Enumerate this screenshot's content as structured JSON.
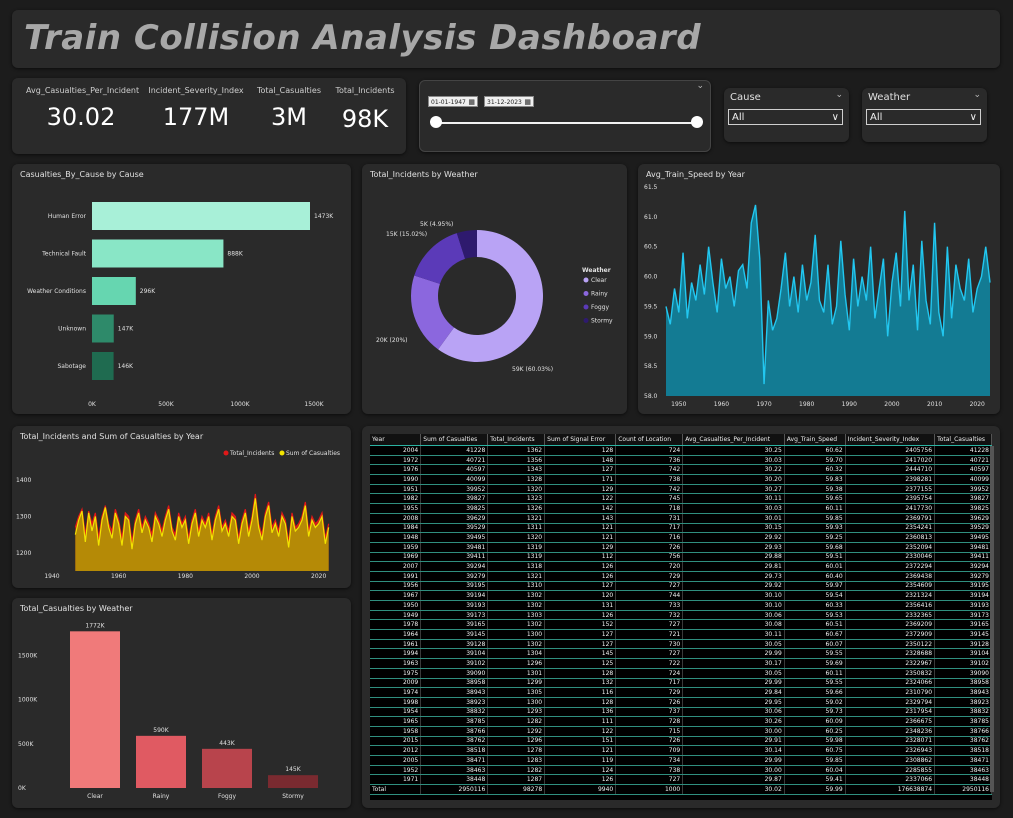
{
  "title": "Train Collision Analysis Dashboard",
  "kpis": [
    {
      "label": "Avg_Casualties_Per_Incident",
      "value": "30.02"
    },
    {
      "label": "Incident_Severity_Index",
      "value": "177M"
    },
    {
      "label": "Total_Casualties",
      "value": "3M"
    },
    {
      "label": "Total_Incidents",
      "value": "98K"
    }
  ],
  "date_slicer": {
    "start": "01-01-1947",
    "end": "31-12-2023",
    "cal_icon": "calendar-icon"
  },
  "cause_slicer": {
    "label": "Cause",
    "selected": "All"
  },
  "weather_slicer": {
    "label": "Weather",
    "selected": "All"
  },
  "cause_chart": {
    "title": "Casualties_By_Cause by Cause",
    "type": "bar",
    "categories": [
      "Human Error",
      "Technical Fault",
      "Weather Conditions",
      "Unknown",
      "Sabotage"
    ],
    "values": [
      1473,
      888,
      296,
      147,
      146
    ],
    "labels": [
      "1473K",
      "888K",
      "296K",
      "147K",
      "146K"
    ],
    "colors": [
      "#a8f0d8",
      "#89e6c6",
      "#66d6b0",
      "#2e8a6a",
      "#1f6b50"
    ],
    "xticks": [
      "0K",
      "500K",
      "1000K",
      "1500K"
    ],
    "xmax": 1500
  },
  "weather_donut": {
    "title": "Total_Incidents by Weather",
    "legend_title": "Weather",
    "slices": [
      {
        "name": "Clear",
        "value": 60.03,
        "color": "#b9a3f5",
        "label": "59K (60.03%)"
      },
      {
        "name": "Rainy",
        "value": 20,
        "color": "#8b67de",
        "label": "20K (20%)"
      },
      {
        "name": "Foggy",
        "value": 15.02,
        "color": "#5b3ab8",
        "label": "15K (15.02%)"
      },
      {
        "name": "Stormy",
        "value": 4.95,
        "color": "#2e1a6e",
        "label": "5K (4.95%)"
      }
    ]
  },
  "speed_chart": {
    "title": "Avg_Train_Speed by Year",
    "type": "area",
    "yticks": [
      "61.5",
      "61.0",
      "60.5",
      "60.0",
      "59.5",
      "59.0",
      "58.5",
      "58.0"
    ],
    "ymin": 58.0,
    "ymax": 61.5,
    "xticks": [
      "1950",
      "1960",
      "1970",
      "1980",
      "1990",
      "2000",
      "2010",
      "2020"
    ],
    "xmin": 1947,
    "xmax": 2023,
    "values": [
      59.5,
      59.2,
      59.8,
      59.4,
      60.4,
      59.3,
      59.9,
      59.6,
      60.2,
      59.7,
      60.5,
      59.9,
      59.4,
      60.3,
      59.8,
      60.0,
      59.5,
      60.1,
      60.2,
      59.8,
      60.9,
      61.2,
      60.3,
      58.2,
      59.6,
      59.1,
      59.3,
      59.8,
      60.4,
      59.5,
      60.0,
      59.4,
      60.2,
      59.6,
      59.9,
      60.7,
      59.6,
      59.4,
      60.2,
      59.2,
      59.5,
      60.6,
      59.7,
      59.1,
      60.3,
      59.5,
      60.0,
      59.6,
      60.5,
      59.3,
      59.8,
      60.3,
      59.0,
      59.9,
      60.4,
      59.5,
      61.1,
      59.6,
      60.2,
      59.1,
      60.6,
      59.6,
      59.2,
      60.9,
      59.4,
      59.0,
      60.5,
      59.3,
      60.2,
      59.8,
      59.6,
      60.3,
      59.4,
      59.8,
      60.0,
      60.5,
      59.9
    ],
    "x": [
      1947,
      1948,
      1949,
      1950,
      1951,
      1952,
      1953,
      1954,
      1955,
      1956,
      1957,
      1958,
      1959,
      1960,
      1961,
      1962,
      1963,
      1964,
      1965,
      1966,
      1967,
      1968,
      1969,
      1970,
      1971,
      1972,
      1973,
      1974,
      1975,
      1976,
      1977,
      1978,
      1979,
      1980,
      1981,
      1982,
      1983,
      1984,
      1985,
      1986,
      1987,
      1988,
      1989,
      1990,
      1991,
      1992,
      1993,
      1994,
      1995,
      1996,
      1997,
      1998,
      1999,
      2000,
      2001,
      2002,
      2003,
      2004,
      2005,
      2006,
      2007,
      2008,
      2009,
      2010,
      2011,
      2012,
      2013,
      2014,
      2015,
      2016,
      2017,
      2018,
      2019,
      2020,
      2021,
      2022,
      2023
    ]
  },
  "incidents_chart": {
    "title": "Total_Incidents and Sum of Casualties by Year",
    "type": "area",
    "legend": [
      {
        "name": "Total_Incidents",
        "color": "#e01818"
      },
      {
        "name": "Sum of Casualties",
        "color": "#f2e400"
      }
    ],
    "yticks": [
      "1400",
      "1300",
      "1200"
    ],
    "ymin": 1150,
    "ymax": 1450,
    "xticks": [
      "1940",
      "1960",
      "1980",
      "2000",
      "2020"
    ],
    "xmin": 1940,
    "xmax": 2024,
    "x": [
      1947,
      1948,
      1949,
      1950,
      1951,
      1952,
      1953,
      1954,
      1955,
      1956,
      1957,
      1958,
      1959,
      1960,
      1961,
      1962,
      1963,
      1964,
      1965,
      1966,
      1967,
      1968,
      1969,
      1970,
      1971,
      1972,
      1973,
      1974,
      1975,
      1976,
      1977,
      1978,
      1979,
      1980,
      1981,
      1982,
      1983,
      1984,
      1985,
      1986,
      1987,
      1988,
      1989,
      1990,
      1991,
      1992,
      1993,
      1994,
      1995,
      1996,
      1997,
      1998,
      1999,
      2000,
      2001,
      2002,
      2003,
      2004,
      2005,
      2006,
      2007,
      2008,
      2009,
      2010,
      2011,
      2012,
      2013,
      2014,
      2015,
      2016,
      2017,
      2018,
      2019,
      2020,
      2021,
      2022,
      2023
    ],
    "incidents": [
      1270,
      1300,
      1320,
      1250,
      1315,
      1280,
      1310,
      1240,
      1300,
      1330,
      1280,
      1260,
      1320,
      1290,
      1240,
      1310,
      1300,
      1230,
      1290,
      1320,
      1270,
      1300,
      1280,
      1250,
      1310,
      1290,
      1260,
      1300,
      1330,
      1270,
      1250,
      1310,
      1280,
      1300,
      1240,
      1290,
      1320,
      1260,
      1300,
      1280,
      1310,
      1250,
      1300,
      1330,
      1270,
      1290,
      1260,
      1310,
      1300,
      1240,
      1290,
      1320,
      1260,
      1300,
      1362,
      1280,
      1250,
      1310,
      1340,
      1270,
      1290,
      1260,
      1310,
      1290,
      1230,
      1310,
      1270,
      1280,
      1300,
      1340,
      1260,
      1300,
      1280,
      1290,
      1310,
      1240,
      1280
    ],
    "casualties": [
      1250,
      1290,
      1315,
      1230,
      1310,
      1260,
      1300,
      1220,
      1290,
      1325,
      1270,
      1240,
      1310,
      1280,
      1220,
      1300,
      1290,
      1210,
      1280,
      1310,
      1255,
      1290,
      1270,
      1230,
      1300,
      1280,
      1245,
      1290,
      1320,
      1260,
      1235,
      1300,
      1270,
      1290,
      1225,
      1280,
      1310,
      1245,
      1290,
      1270,
      1300,
      1235,
      1290,
      1320,
      1260,
      1280,
      1245,
      1300,
      1290,
      1225,
      1280,
      1310,
      1245,
      1290,
      1350,
      1270,
      1235,
      1300,
      1330,
      1255,
      1280,
      1245,
      1300,
      1280,
      1215,
      1300,
      1260,
      1270,
      1290,
      1330,
      1245,
      1290,
      1270,
      1280,
      1300,
      1225,
      1270
    ]
  },
  "casualties_weather": {
    "title": "Total_Casualties by Weather",
    "type": "bar",
    "categories": [
      "Clear",
      "Rainy",
      "Foggy",
      "Stormy"
    ],
    "values": [
      1772,
      590,
      443,
      145
    ],
    "labels": [
      "1772K",
      "590K",
      "443K",
      "145K"
    ],
    "colors": [
      "#f07a7a",
      "#e05a62",
      "#b8444c",
      "#7a2a30"
    ],
    "yticks": [
      "1500K",
      "1000K",
      "500K",
      "0K"
    ],
    "ymax": 1900
  },
  "table": {
    "columns": [
      "Year",
      "Sum of Casualties",
      "Total_Incidents",
      "Sum of Signal Error",
      "Count of Location",
      "Avg_Casualties_Per_Incident",
      "Avg_Train_Speed",
      "Incident_Severity_Index",
      "Total_Casualties"
    ],
    "rows": [
      [
        "2004",
        "41228",
        "1362",
        "128",
        "724",
        "30.25",
        "60.62",
        "2405756",
        "41228"
      ],
      [
        "1972",
        "40721",
        "1356",
        "148",
        "736",
        "30.03",
        "59.70",
        "2417020",
        "40721"
      ],
      [
        "1976",
        "40597",
        "1343",
        "127",
        "742",
        "30.22",
        "60.32",
        "2444710",
        "40597"
      ],
      [
        "1990",
        "40099",
        "1328",
        "171",
        "738",
        "30.20",
        "59.83",
        "2398281",
        "40099"
      ],
      [
        "1951",
        "39952",
        "1320",
        "129",
        "742",
        "30.27",
        "59.38",
        "2377155",
        "39952"
      ],
      [
        "1982",
        "39827",
        "1323",
        "122",
        "745",
        "30.11",
        "59.65",
        "2395754",
        "39827"
      ],
      [
        "1955",
        "39825",
        "1326",
        "142",
        "718",
        "30.03",
        "60.11",
        "2417730",
        "39825"
      ],
      [
        "2008",
        "39629",
        "1321",
        "143",
        "731",
        "30.01",
        "59.85",
        "2369791",
        "39629"
      ],
      [
        "1984",
        "39529",
        "1311",
        "121",
        "717",
        "30.15",
        "59.93",
        "2354241",
        "39529"
      ],
      [
        "1948",
        "39495",
        "1320",
        "121",
        "716",
        "29.92",
        "59.25",
        "2360813",
        "39495"
      ],
      [
        "1959",
        "39481",
        "1319",
        "129",
        "726",
        "29.93",
        "59.68",
        "2352094",
        "39481"
      ],
      [
        "1969",
        "39411",
        "1319",
        "112",
        "756",
        "29.88",
        "59.51",
        "2330046",
        "39411"
      ],
      [
        "2007",
        "39294",
        "1318",
        "126",
        "720",
        "29.81",
        "60.01",
        "2372294",
        "39294"
      ],
      [
        "1991",
        "39279",
        "1321",
        "126",
        "729",
        "29.73",
        "60.40",
        "2369438",
        "39279"
      ],
      [
        "1956",
        "39195",
        "1310",
        "127",
        "727",
        "29.92",
        "59.97",
        "2354609",
        "39195"
      ],
      [
        "1967",
        "39194",
        "1302",
        "120",
        "744",
        "30.10",
        "59.54",
        "2321324",
        "39194"
      ],
      [
        "1950",
        "39193",
        "1302",
        "131",
        "733",
        "30.10",
        "60.33",
        "2356416",
        "39193"
      ],
      [
        "1949",
        "39173",
        "1303",
        "126",
        "732",
        "30.06",
        "59.53",
        "2332365",
        "39173"
      ],
      [
        "1978",
        "39165",
        "1302",
        "152",
        "727",
        "30.08",
        "60.51",
        "2369209",
        "39165"
      ],
      [
        "1964",
        "39145",
        "1300",
        "127",
        "721",
        "30.11",
        "60.67",
        "2372909",
        "39145"
      ],
      [
        "1961",
        "39128",
        "1302",
        "127",
        "730",
        "30.05",
        "60.07",
        "2350122",
        "39128"
      ],
      [
        "1994",
        "39104",
        "1304",
        "145",
        "727",
        "29.99",
        "59.55",
        "2328688",
        "39104"
      ],
      [
        "1963",
        "39102",
        "1296",
        "125",
        "722",
        "30.17",
        "59.69",
        "2322967",
        "39102"
      ],
      [
        "1975",
        "39090",
        "1301",
        "128",
        "724",
        "30.05",
        "60.11",
        "2350832",
        "39090"
      ],
      [
        "2009",
        "38958",
        "1299",
        "132",
        "717",
        "29.99",
        "59.55",
        "2324066",
        "38958"
      ],
      [
        "1974",
        "38943",
        "1305",
        "116",
        "729",
        "29.84",
        "59.66",
        "2310790",
        "38943"
      ],
      [
        "1998",
        "38923",
        "1300",
        "128",
        "726",
        "29.95",
        "59.02",
        "2329794",
        "38923"
      ],
      [
        "1954",
        "38832",
        "1293",
        "136",
        "737",
        "30.06",
        "59.73",
        "2317954",
        "38832"
      ],
      [
        "1965",
        "38785",
        "1282",
        "111",
        "728",
        "30.26",
        "60.09",
        "2366675",
        "38785"
      ],
      [
        "1958",
        "38766",
        "1292",
        "122",
        "715",
        "30.00",
        "60.25",
        "2348236",
        "38766"
      ],
      [
        "2015",
        "38762",
        "1296",
        "151",
        "726",
        "29.91",
        "59.98",
        "2328071",
        "38762"
      ],
      [
        "2012",
        "38518",
        "1278",
        "121",
        "709",
        "30.14",
        "60.75",
        "2326943",
        "38518"
      ],
      [
        "2005",
        "38471",
        "1283",
        "119",
        "734",
        "29.99",
        "59.85",
        "2308862",
        "38471"
      ],
      [
        "1952",
        "38463",
        "1282",
        "124",
        "738",
        "30.00",
        "60.04",
        "2285855",
        "38463"
      ],
      [
        "1971",
        "38448",
        "1287",
        "126",
        "727",
        "29.87",
        "59.41",
        "2337066",
        "38448"
      ]
    ],
    "total": [
      "Total",
      "2950116",
      "98278",
      "9940",
      "1000",
      "30.02",
      "59.99",
      "176638874",
      "2950116"
    ]
  }
}
